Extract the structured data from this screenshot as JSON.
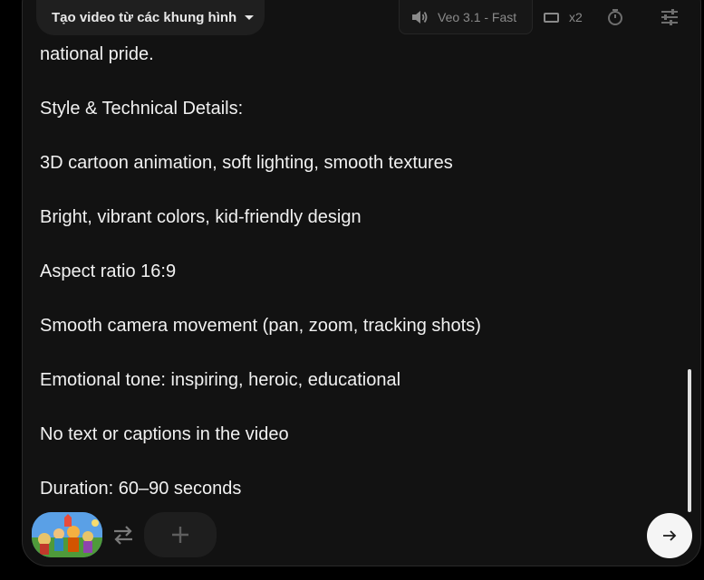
{
  "toolbar": {
    "mode_label": "Tạo video từ các khung hình",
    "model_label": "Veo 3.1 - Fast",
    "output_count": "x2",
    "icons": {
      "mode_caret": "caret-down-icon",
      "audio": "volume-icon",
      "aspect_ratio": "landscape-ratio-icon",
      "timer": "timer-icon",
      "settings": "sliders-icon"
    }
  },
  "prompt": {
    "lines": [
      "national pride.",
      "Style & Technical Details:",
      "3D cartoon animation, soft lighting, smooth textures",
      "Bright, vibrant colors, kid-friendly design",
      "Aspect ratio 16:9",
      "Smooth camera movement (pan, zoom, tracking shots)",
      "Emotional tone: inspiring, heroic, educational",
      "No text or captions in the video",
      "Duration: 60–90 seconds"
    ]
  },
  "bottom_bar": {
    "icons": {
      "frame_thumbnail": "start-frame-thumbnail",
      "swap": "swap-arrows-icon",
      "add": "plus-icon",
      "send": "arrow-right-icon"
    }
  },
  "colors": {
    "background": "#000000",
    "panel": "#121212",
    "text": "#f1f1f1",
    "muted": "#8a8a8a",
    "send_button": "#f5f5f5"
  }
}
